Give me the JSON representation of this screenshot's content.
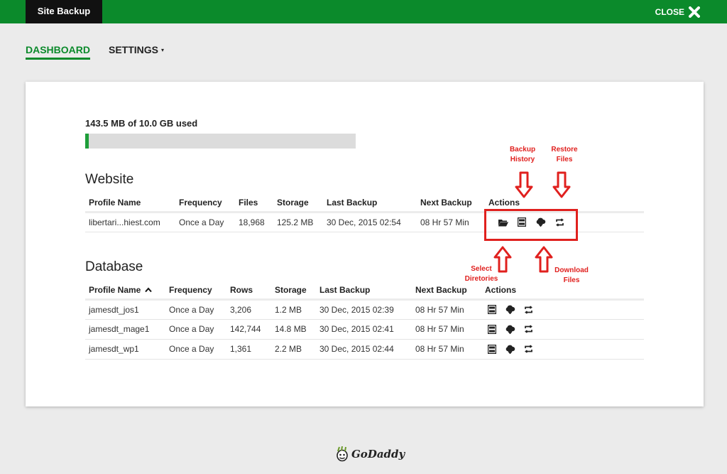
{
  "header": {
    "title": "Site Backup",
    "close_label": "CLOSE"
  },
  "nav": {
    "tabs": [
      {
        "label": "DASHBOARD",
        "active": true
      },
      {
        "label": "SETTINGS",
        "caret": "▾"
      }
    ]
  },
  "usage": {
    "text": "143.5 MB of 10.0 GB used",
    "fraction": 0.014
  },
  "website": {
    "title": "Website",
    "headers": [
      "Profile Name",
      "Frequency",
      "Files",
      "Storage",
      "Last Backup",
      "Next Backup",
      "Actions"
    ],
    "rows": [
      {
        "profile": "libertari...hiest.com",
        "frequency": "Once a Day",
        "files": "18,968",
        "storage": "125.2 MB",
        "last": "30 Dec, 2015 02:54",
        "next": "08 Hr 57 Min"
      }
    ]
  },
  "database": {
    "title": "Database",
    "headers": [
      "Profile Name",
      "Frequency",
      "Rows",
      "Storage",
      "Last Backup",
      "Next Backup",
      "Actions"
    ],
    "sort_indicator": "⌃",
    "rows": [
      {
        "profile": "jamesdt_jos1",
        "frequency": "Once a Day",
        "rows": "3,206",
        "storage": "1.2 MB",
        "last": "30 Dec, 2015 02:39",
        "next": "08 Hr 57 Min"
      },
      {
        "profile": "jamesdt_mage1",
        "frequency": "Once a Day",
        "rows": "142,744",
        "storage": "14.8 MB",
        "last": "30 Dec, 2015 02:41",
        "next": "08 Hr 57 Min"
      },
      {
        "profile": "jamesdt_wp1",
        "frequency": "Once a Day",
        "rows": "1,361",
        "storage": "2.2 MB",
        "last": "30 Dec, 2015 02:44",
        "next": "08 Hr 57 Min"
      }
    ]
  },
  "annotations": {
    "backup_history": [
      "Backup",
      "History"
    ],
    "restore_files": [
      "Restore",
      "Files"
    ],
    "select_directories": [
      "Select",
      "Diretories"
    ],
    "download_files": [
      "Download",
      "Files"
    ]
  },
  "footer": {
    "logo_text": "GoDaddy"
  },
  "colors": {
    "brand_green": "#0b8a2b",
    "annotation_red": "#e0201e"
  },
  "icons": [
    "close-icon",
    "folder-icon",
    "history-icon",
    "cloud-download-icon",
    "restore-icon",
    "godaddy-logo-icon"
  ]
}
